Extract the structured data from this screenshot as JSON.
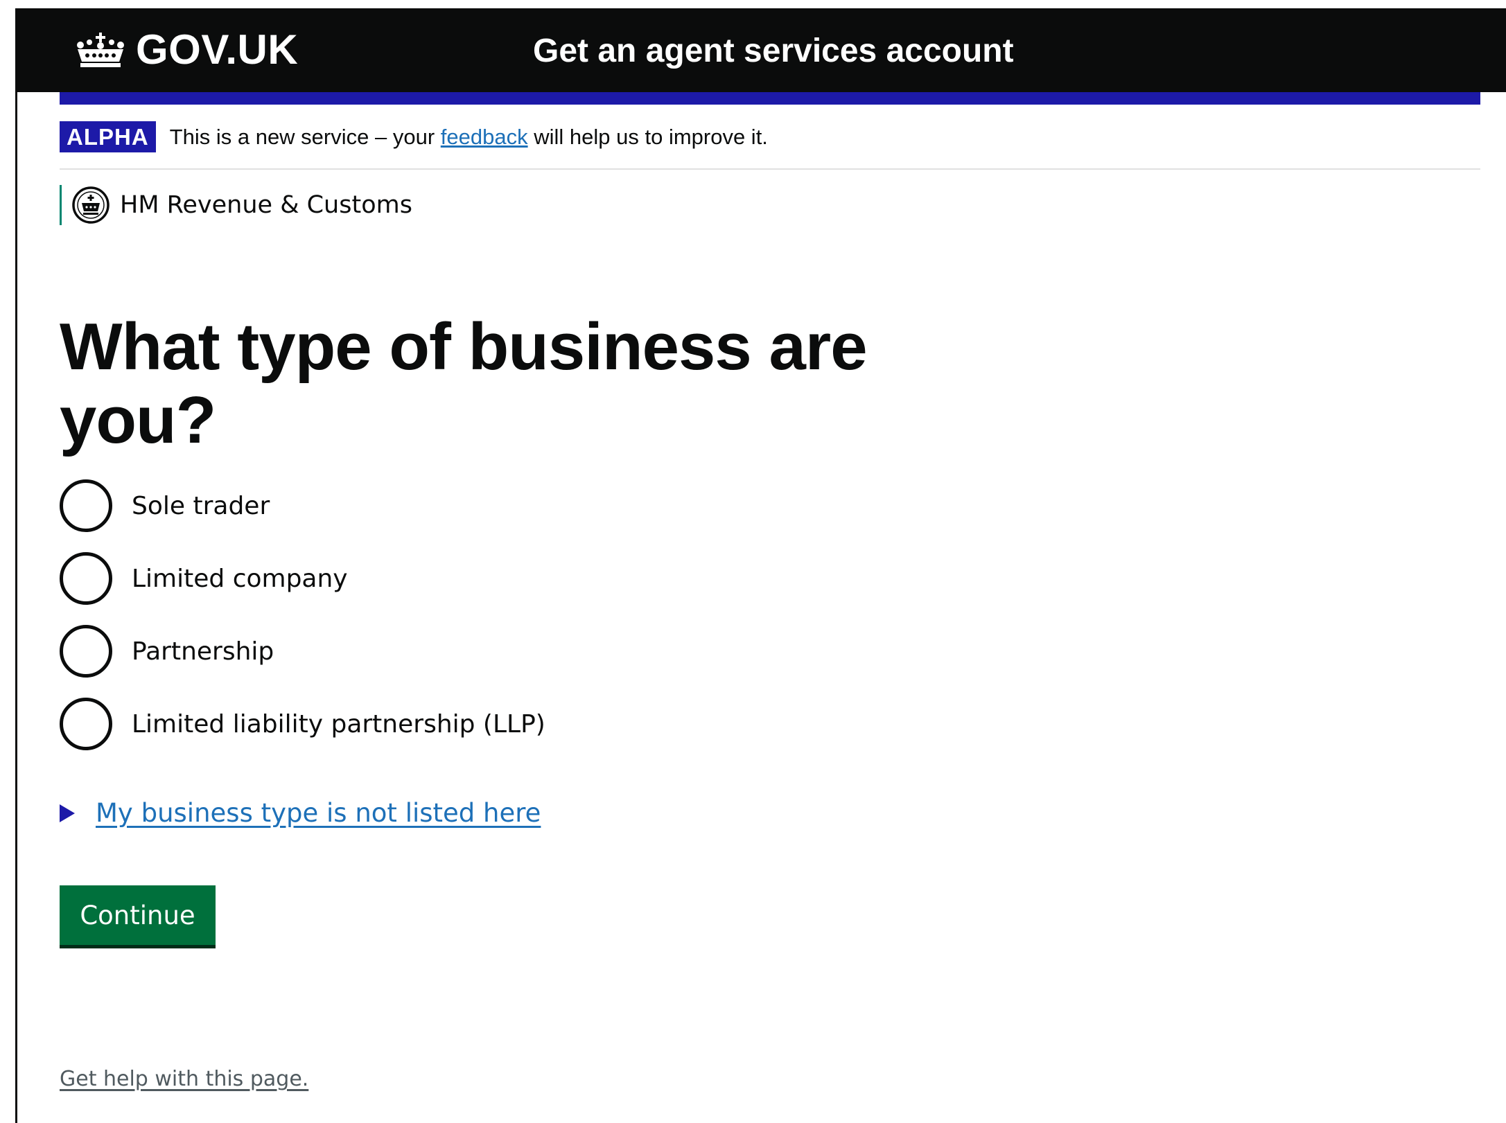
{
  "header": {
    "logo_text": "GOV.UK",
    "logo_icon": "crown-icon",
    "service_name": "Get an agent services account"
  },
  "phase_banner": {
    "tag": "ALPHA",
    "text_before": "This is a new service – your",
    "link_text": "feedback",
    "text_after": "will help us to improve it."
  },
  "organisation": {
    "name": "HM Revenue & Customs",
    "icon": "hmrc-crest-icon"
  },
  "question": {
    "heading": "What type of business are you?",
    "options": [
      {
        "label": "Sole trader",
        "selected": false
      },
      {
        "label": "Limited company",
        "selected": false
      },
      {
        "label": "Partnership",
        "selected": false
      },
      {
        "label": "Limited liability partnership (LLP)",
        "selected": false
      }
    ]
  },
  "details": {
    "summary": "My business type is not listed here"
  },
  "actions": {
    "continue_label": "Continue"
  },
  "footer": {
    "help_link": "Get help with this page."
  },
  "colors": {
    "header_bg": "#0b0c0c",
    "brand_blue": "#1d1aa8",
    "link": "#1d70b8",
    "button_green": "#00703c",
    "org_rule": "#008670"
  }
}
